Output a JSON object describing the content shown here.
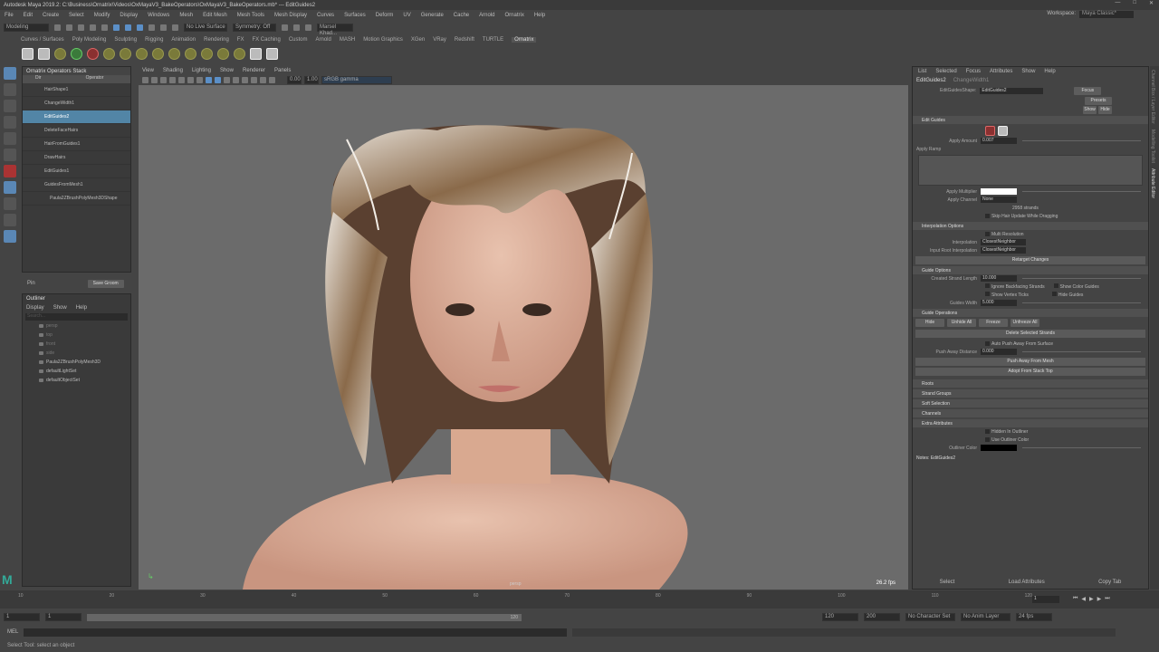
{
  "window": {
    "title": "Autodesk Maya 2019.2: C:\\Business\\Ornatrix\\Videos\\OxMayaV3_BakeOperators\\OxMayaV3_BakeOperators.mb* --- EditGuides2"
  },
  "menu": [
    "File",
    "Edit",
    "Create",
    "Select",
    "Modify",
    "Display",
    "Windows",
    "Mesh",
    "Edit Mesh",
    "Mesh Tools",
    "Mesh Display",
    "Curves",
    "Surfaces",
    "Deform",
    "UV",
    "Generate",
    "Cache",
    "Arnold",
    "Ornatrix",
    "Help"
  ],
  "workspace": {
    "label": "Workspace:",
    "value": "Maya Classic*"
  },
  "status": {
    "mode": "Modeling",
    "live": "No Live Surface",
    "symmetry": "Symmetry: Off",
    "user": "Marsel Khad..."
  },
  "shelf_tabs": [
    "Curves / Surfaces",
    "Poly Modeling",
    "Sculpting",
    "Rigging",
    "Animation",
    "Rendering",
    "FX",
    "FX Caching",
    "Custom",
    "Arnold",
    "MASH",
    "Motion Graphics",
    "XGen",
    "VRay",
    "Redshift",
    "TURTLE",
    "Ornatrix"
  ],
  "shelf_active": "Ornatrix",
  "opstack": {
    "title": "Ornatrix Operators Stack",
    "col1": "Dir",
    "col2": "Operator",
    "items": [
      "HairShape1",
      "ChangeWidth1",
      "EditGuides2",
      "DeleteFaceHairs",
      "HairFromGuides1",
      "DrawHairs",
      "EditGuides1",
      "GuidesFromMesh1",
      "Paula2ZBrushPolyMesh3DShape"
    ],
    "pin": "Pin",
    "save": "Save Groom"
  },
  "outliner": {
    "title": "Outliner",
    "menu": [
      "Display",
      "Show",
      "Help"
    ],
    "search": "Search...",
    "items": [
      "persp",
      "top",
      "front",
      "side",
      "Paula2ZBrushPolyMesh3D",
      "defaultLightSet",
      "defaultObjectSet"
    ]
  },
  "viewport": {
    "menu": [
      "View",
      "Shading",
      "Lighting",
      "Show",
      "Renderer",
      "Panels"
    ],
    "near": "0.00",
    "far": "1.00",
    "colorspace": "sRGB gamma",
    "fps": "26.2 fps",
    "camera": "persp"
  },
  "attr": {
    "menu": [
      "List",
      "Selected",
      "Focus",
      "Attributes",
      "Show",
      "Help"
    ],
    "tabs": [
      "EditGuides2",
      "ChangeWidth1"
    ],
    "node_label": "EditGuidesShape:",
    "node_value": "EditGuides2",
    "focus": "Focus",
    "presets": "Presets",
    "show": "Show",
    "hide": "Hide",
    "edit_guides": "Edit Guides",
    "apply_amount": "Apply Amount",
    "apply_amount_val": "0.007",
    "apply_ramp": "Apply Ramp",
    "apply_multiplier": "Apply Multiplier",
    "apply_channel": "Apply Channel",
    "apply_channel_val": "None",
    "strands": "2958 strands",
    "skip_hair": "Skip Hair Update While Dragging",
    "interp": "Interpolation Options",
    "multi_res": "Multi Resolution",
    "interpolation": "Interpolation",
    "interpolation_val": "ClosestNeighbor",
    "input_root": "Input Root Interpolation",
    "input_root_val": "ClosestNeighbor",
    "retarget": "Retarget Changes",
    "guide_options": "Guide Options",
    "created_len": "Created Strand Length",
    "created_len_val": "10.000",
    "ignore_bf": "Ignore Backfacing Strands",
    "show_color": "Show Color Guides",
    "show_ticks": "Show Vertex Ticks",
    "hide_guides": "Hide Guides",
    "guides_width": "Guides Width",
    "guides_width_val": "5.000",
    "guide_ops": "Guide Operations",
    "hide_btn": "Hide",
    "unhide_all": "Unhide All",
    "freeze": "Freeze",
    "unfreeze_all": "Unfreeze All",
    "delete_sel": "Delete Selected Strands",
    "auto_push": "Auto Push Away From Surface",
    "push_dist": "Push Away Distance",
    "push_dist_val": "0.000",
    "push_mesh": "Push Away From Mesh",
    "adopt": "Adopt From Stack Top",
    "collapsed": [
      "Roots",
      "Strand Groups",
      "Soft Selection",
      "Channels",
      "Extra Attributes"
    ],
    "hidden_outliner": "Hidden In Outliner",
    "use_outliner_color": "Use Outliner Color",
    "outliner_color": "Outliner Color",
    "notes": "Notes: EditGuides2",
    "select": "Select",
    "load": "Load Attributes",
    "copy_tab": "Copy Tab"
  },
  "side_tabs": [
    "Channel Box / Layer Editor",
    "Modelling Toolkit",
    "Attribute Editor"
  ],
  "timeline": {
    "ticks": [
      "10",
      "20",
      "30",
      "40",
      "50",
      "60",
      "70",
      "80",
      "90",
      "100",
      "110",
      "120"
    ],
    "current": "1"
  },
  "range": {
    "start": "1",
    "inner_start": "1",
    "inner_end": "120",
    "end": "120",
    "max": "200",
    "char_set": "No Character Set",
    "anim_layer": "No Anim Layer",
    "fps": "24 fps"
  },
  "cmd": {
    "lang": "MEL"
  },
  "help_line": "Select Tool: select an object"
}
